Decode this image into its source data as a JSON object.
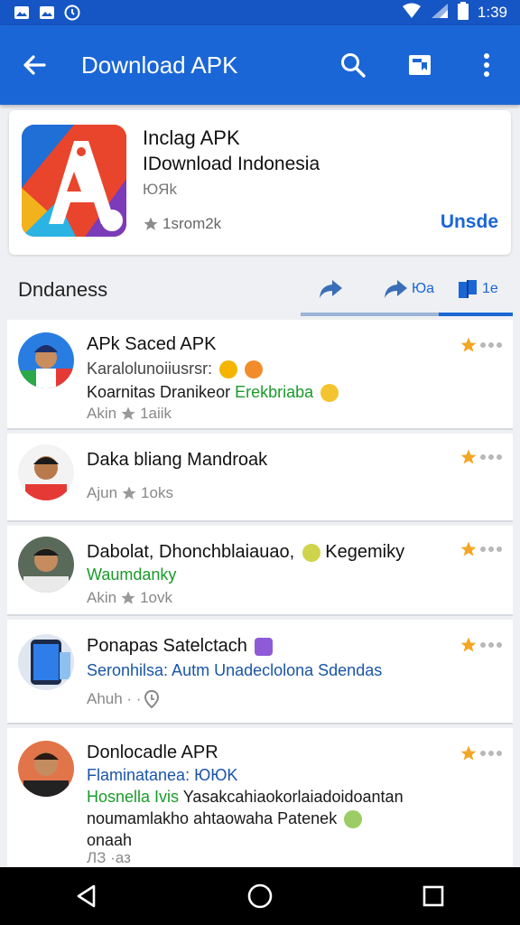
{
  "status_bar": {
    "time": "1:39",
    "left_icons": [
      "image-icon",
      "image-icon",
      "clock-icon"
    ],
    "right_icons": [
      "wifi-icon",
      "signal-icon",
      "battery-icon"
    ]
  },
  "app_bar": {
    "title": "Download APK",
    "icons": [
      "back-arrow-icon",
      "search-icon",
      "bookmark-icon",
      "more-vert-icon"
    ],
    "color": "#1a66d6"
  },
  "app_card": {
    "name": "Inclag APK",
    "subtitle": "IDownload Indonesia",
    "size": "ЮЯk",
    "rating": "1srom2k",
    "action": "Unsde"
  },
  "section": {
    "title": "Dndaness",
    "tabs": [
      {
        "icon": "share-icon",
        "label": ""
      },
      {
        "icon": "share-icon",
        "label": "Юa"
      },
      {
        "icon": "book-icon",
        "label": "1e"
      }
    ]
  },
  "items": [
    {
      "title": "APk Saced APK",
      "line1": "Karalolunoiiusrsr:",
      "line2_a": "Koarnitas Dranikeor",
      "line2_b": "Erekbriaba",
      "meta": "Akin",
      "meta_rating": "1aiik"
    },
    {
      "title": "Daka bliang Mandroak",
      "meta": "Ajun",
      "meta_rating": "1oks"
    },
    {
      "title": "Dabolat, Dhonchblaiauao,",
      "title_b": "Kegemiky",
      "line1": "Waumdanky",
      "meta": "Akin",
      "meta_rating": "1ovk"
    },
    {
      "title": "Ponapas Satelctach",
      "line1": "Seronhilsa: Autm Unadeclolona Sdendas",
      "meta": "Ahuh · ·"
    },
    {
      "title": "Donlocadle APR",
      "line1": "Flaminatanea: ЮЮK",
      "line2_a": "Hosnella Ivis",
      "line2_b": "Yasakcahiaokorlaiadoidoantan",
      "line3": "noumamlakho ahtaowaha Patenek",
      "line4": "onaah",
      "meta": "ЛЗ ·аз"
    }
  ],
  "nav_bar": {
    "icons": [
      "back-triangle-icon",
      "home-circle-icon",
      "recents-square-icon"
    ]
  }
}
